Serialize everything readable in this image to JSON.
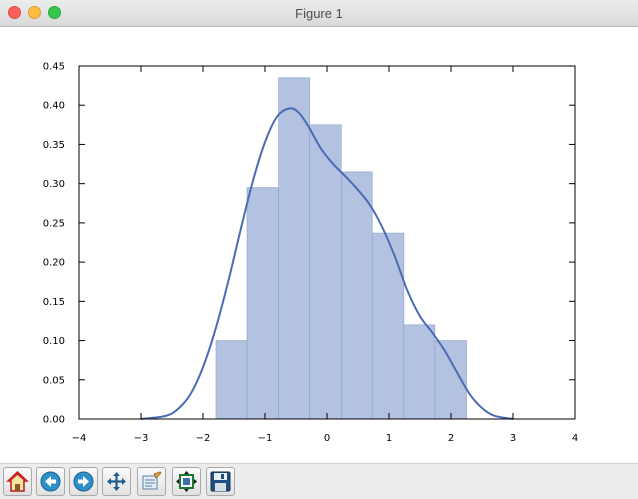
{
  "window": {
    "title": "Figure 1",
    "traffic_colors": {
      "close": "#fc605c",
      "minimize": "#fdbc40",
      "zoom": "#34c84a"
    }
  },
  "toolbar": {
    "items": [
      {
        "icon": "home-icon",
        "tooltip": "Reset original view"
      },
      {
        "icon": "back-arrow-icon",
        "tooltip": "Back to previous view"
      },
      {
        "icon": "forward-arrow-icon",
        "tooltip": "Forward to next view"
      },
      {
        "icon": "pan-move-icon",
        "tooltip": "Pan axes"
      },
      {
        "icon": "zoom-rect-icon",
        "tooltip": "Zoom to rectangle"
      },
      {
        "icon": "configure-subplots-icon",
        "tooltip": "Configure subplots"
      },
      {
        "icon": "save-floppy-icon",
        "tooltip": "Save the figure"
      }
    ]
  },
  "chart_data": {
    "type": "bar",
    "subtype": "histogram with density curve",
    "title": "",
    "xlabel": "",
    "ylabel": "",
    "xlim": [
      -4,
      4
    ],
    "ylim": [
      0,
      0.45
    ],
    "xticks": [
      "−4",
      "−3",
      "−2",
      "−1",
      "0",
      "1",
      "2",
      "3",
      "4"
    ],
    "xtick_values": [
      -4,
      -3,
      -2,
      -1,
      0,
      1,
      2,
      3,
      4
    ],
    "yticks": [
      "0.00",
      "0.05",
      "0.10",
      "0.15",
      "0.20",
      "0.25",
      "0.30",
      "0.35",
      "0.40",
      "0.45"
    ],
    "ytick_values": [
      0,
      0.05,
      0.1,
      0.15,
      0.2,
      0.25,
      0.3,
      0.35,
      0.4,
      0.45
    ],
    "grid": false,
    "bar_color": "#b3c2e0",
    "bar_edge": "#8c9fc6",
    "line_color": "#4a6cb3",
    "bins": [
      {
        "x0": -1.79,
        "x1": -1.29,
        "value": 0.1
      },
      {
        "x0": -1.29,
        "x1": -0.78,
        "value": 0.295
      },
      {
        "x0": -0.78,
        "x1": -0.28,
        "value": 0.435
      },
      {
        "x0": -0.28,
        "x1": 0.23,
        "value": 0.375
      },
      {
        "x0": 0.23,
        "x1": 0.73,
        "value": 0.315
      },
      {
        "x0": 0.73,
        "x1": 1.24,
        "value": 0.237
      },
      {
        "x0": 1.24,
        "x1": 1.74,
        "value": 0.12
      },
      {
        "x0": 1.74,
        "x1": 2.25,
        "value": 0.1
      }
    ],
    "kde": {
      "x": [
        -3.0,
        -2.6,
        -2.4,
        -2.2,
        -2.0,
        -1.8,
        -1.6,
        -1.4,
        -1.2,
        -1.0,
        -0.8,
        -0.6,
        -0.45,
        -0.3,
        -0.1,
        0.1,
        0.3,
        0.5,
        0.7,
        0.9,
        1.1,
        1.3,
        1.5,
        1.7,
        1.9,
        2.1,
        2.3,
        2.5,
        2.7,
        3.0
      ],
      "y": [
        0.0,
        0.004,
        0.013,
        0.032,
        0.066,
        0.114,
        0.173,
        0.239,
        0.302,
        0.353,
        0.386,
        0.396,
        0.39,
        0.373,
        0.345,
        0.325,
        0.309,
        0.292,
        0.272,
        0.243,
        0.206,
        0.163,
        0.131,
        0.11,
        0.087,
        0.059,
        0.032,
        0.014,
        0.004,
        0.0
      ]
    }
  }
}
